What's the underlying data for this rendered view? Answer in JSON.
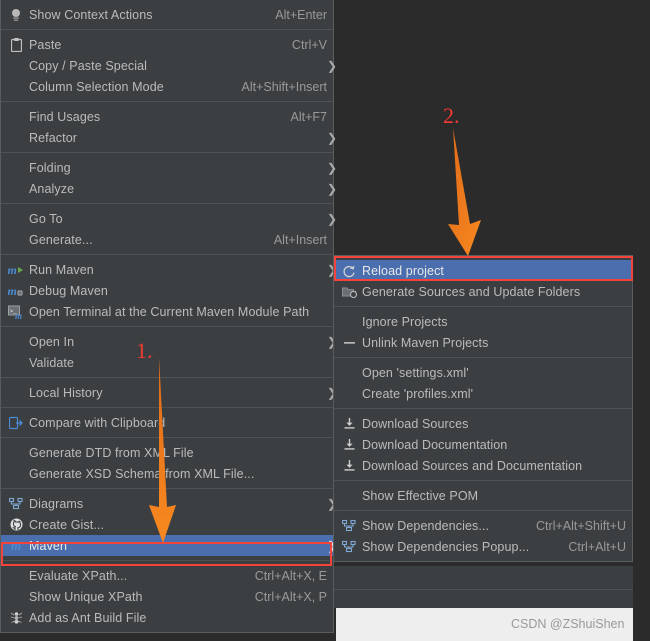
{
  "app": {
    "theme": "darcula",
    "bg": "#2b2b2b",
    "menu_bg": "#3c3f41",
    "highlight": "#4b6eaf",
    "annotation_red": "#f4433a",
    "annotation_orange": "#f58220",
    "text": "#bbbbbb"
  },
  "context_menu": {
    "name": "editor-context-menu",
    "groups": [
      {
        "items": [
          {
            "icon": "lightbulb-icon",
            "label": "Show Context Actions",
            "accel": "Alt+Enter",
            "arrow": false,
            "selected": false
          }
        ]
      },
      {
        "items": [
          {
            "icon": "clipboard-paste-icon",
            "label": "Paste",
            "accel": "Ctrl+V",
            "arrow": false,
            "selected": false
          },
          {
            "icon": "",
            "label": "Copy / Paste Special",
            "accel": "",
            "arrow": true,
            "selected": false
          },
          {
            "icon": "",
            "label": "Column Selection Mode",
            "accel": "Alt+Shift+Insert",
            "arrow": false,
            "selected": false
          }
        ]
      },
      {
        "items": [
          {
            "icon": "",
            "label": "Find Usages",
            "accel": "Alt+F7",
            "arrow": false,
            "selected": false
          },
          {
            "icon": "",
            "label": "Refactor",
            "accel": "",
            "arrow": true,
            "selected": false
          }
        ]
      },
      {
        "items": [
          {
            "icon": "",
            "label": "Folding",
            "accel": "",
            "arrow": true,
            "selected": false
          },
          {
            "icon": "",
            "label": "Analyze",
            "accel": "",
            "arrow": true,
            "selected": false
          }
        ]
      },
      {
        "items": [
          {
            "icon": "",
            "label": "Go To",
            "accel": "",
            "arrow": true,
            "selected": false
          },
          {
            "icon": "",
            "label": "Generate...",
            "accel": "Alt+Insert",
            "arrow": false,
            "selected": false
          }
        ]
      },
      {
        "items": [
          {
            "icon": "maven-run-icon",
            "label": "Run Maven",
            "accel": "",
            "arrow": true,
            "selected": false
          },
          {
            "icon": "maven-debug-icon",
            "label": "Debug Maven",
            "accel": "",
            "arrow": false,
            "selected": false
          },
          {
            "icon": "terminal-maven-icon",
            "label": "Open Terminal at the Current Maven Module Path",
            "accel": "",
            "arrow": false,
            "selected": false
          }
        ]
      },
      {
        "items": [
          {
            "icon": "",
            "label": "Open In",
            "accel": "",
            "arrow": true,
            "selected": false
          },
          {
            "icon": "",
            "label": "Validate",
            "accel": "",
            "arrow": false,
            "selected": false
          }
        ]
      },
      {
        "items": [
          {
            "icon": "",
            "label": "Local History",
            "accel": "",
            "arrow": true,
            "selected": false
          }
        ]
      },
      {
        "items": [
          {
            "icon": "compare-clipboard-icon",
            "label": "Compare with Clipboard",
            "accel": "",
            "arrow": false,
            "selected": false
          }
        ]
      },
      {
        "items": [
          {
            "icon": "",
            "label": "Generate DTD from XML File",
            "accel": "",
            "arrow": false,
            "selected": false
          },
          {
            "icon": "",
            "label": "Generate XSD Schema from XML File...",
            "accel": "",
            "arrow": false,
            "selected": false
          }
        ]
      },
      {
        "items": [
          {
            "icon": "diagram-icon",
            "label": "Diagrams",
            "accel": "",
            "arrow": true,
            "selected": false
          },
          {
            "icon": "github-icon",
            "label": "Create Gist...",
            "accel": "",
            "arrow": false,
            "selected": false
          },
          {
            "icon": "maven-icon",
            "label": "Maven",
            "accel": "",
            "arrow": true,
            "selected": true
          }
        ]
      },
      {
        "items": [
          {
            "icon": "",
            "label": "Evaluate XPath...",
            "accel": "Ctrl+Alt+X, E",
            "arrow": false,
            "selected": false
          },
          {
            "icon": "",
            "label": "Show Unique XPath",
            "accel": "Ctrl+Alt+X, P",
            "arrow": false,
            "selected": false
          },
          {
            "icon": "ant-icon",
            "label": "Add as Ant Build File",
            "accel": "",
            "arrow": false,
            "selected": false
          }
        ]
      }
    ]
  },
  "maven_submenu": {
    "name": "maven-submenu",
    "groups": [
      {
        "items": [
          {
            "icon": "reload-icon",
            "label": "Reload project",
            "accel": "",
            "arrow": false,
            "selected": true
          },
          {
            "icon": "generate-sources-icon",
            "label": "Generate Sources and Update Folders",
            "accel": "",
            "arrow": false,
            "selected": false
          }
        ]
      },
      {
        "items": [
          {
            "icon": "",
            "label": "Ignore Projects",
            "accel": "",
            "arrow": false,
            "selected": false
          },
          {
            "icon": "unlink-icon",
            "label": "Unlink Maven Projects",
            "accel": "",
            "arrow": false,
            "selected": false
          }
        ]
      },
      {
        "items": [
          {
            "icon": "",
            "label": "Open 'settings.xml'",
            "accel": "",
            "arrow": false,
            "selected": false
          },
          {
            "icon": "",
            "label": "Create 'profiles.xml'",
            "accel": "",
            "arrow": false,
            "selected": false
          }
        ]
      },
      {
        "items": [
          {
            "icon": "download-icon",
            "label": "Download Sources",
            "accel": "",
            "arrow": false,
            "selected": false
          },
          {
            "icon": "download-icon",
            "label": "Download Documentation",
            "accel": "",
            "arrow": false,
            "selected": false
          },
          {
            "icon": "download-icon",
            "label": "Download Sources and Documentation",
            "accel": "",
            "arrow": false,
            "selected": false
          }
        ]
      },
      {
        "items": [
          {
            "icon": "",
            "label": "Show Effective POM",
            "accel": "",
            "arrow": false,
            "selected": false
          }
        ]
      },
      {
        "items": [
          {
            "icon": "diagram-icon",
            "label": "Show Dependencies...",
            "accel": "Ctrl+Alt+Shift+U",
            "arrow": false,
            "selected": false
          },
          {
            "icon": "diagram-icon",
            "label": "Show Dependencies Popup...",
            "accel": "Ctrl+Alt+U",
            "arrow": false,
            "selected": false
          }
        ]
      }
    ]
  },
  "annotations": [
    {
      "name": "step-1-label",
      "text": "1."
    },
    {
      "name": "step-2-label",
      "text": "2."
    }
  ],
  "watermark": {
    "text": "CSDN @ZShuiShen"
  }
}
